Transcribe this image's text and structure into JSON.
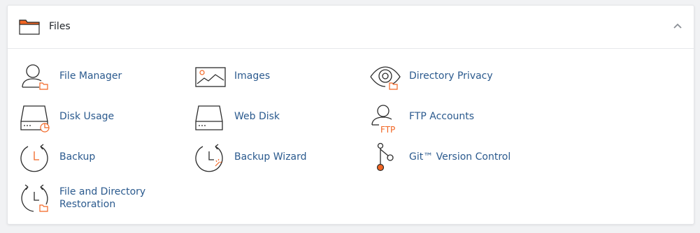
{
  "panel": {
    "title": "Files",
    "header_icon": "folder-icon",
    "collapse_icon": "chevron-up-icon"
  },
  "colors": {
    "link": "#2b5a8e",
    "icon_stroke": "#2b2b2b",
    "accent": "#f26522"
  },
  "items": [
    {
      "label": "File Manager",
      "icon": "file-manager-icon"
    },
    {
      "label": "Images",
      "icon": "images-icon"
    },
    {
      "label": "Directory Privacy",
      "icon": "directory-privacy-icon"
    },
    {
      "label": "Disk Usage",
      "icon": "disk-usage-icon"
    },
    {
      "label": "Web Disk",
      "icon": "web-disk-icon"
    },
    {
      "label": "FTP Accounts",
      "icon": "ftp-accounts-icon",
      "icon_text": "FTP"
    },
    {
      "label": "Backup",
      "icon": "backup-icon"
    },
    {
      "label": "Backup Wizard",
      "icon": "backup-wizard-icon"
    },
    {
      "label": "Git™ Version Control",
      "icon": "git-version-control-icon"
    },
    {
      "label_line1": "File and Directory",
      "label_line2": "Restoration",
      "icon": "file-directory-restoration-icon"
    }
  ]
}
